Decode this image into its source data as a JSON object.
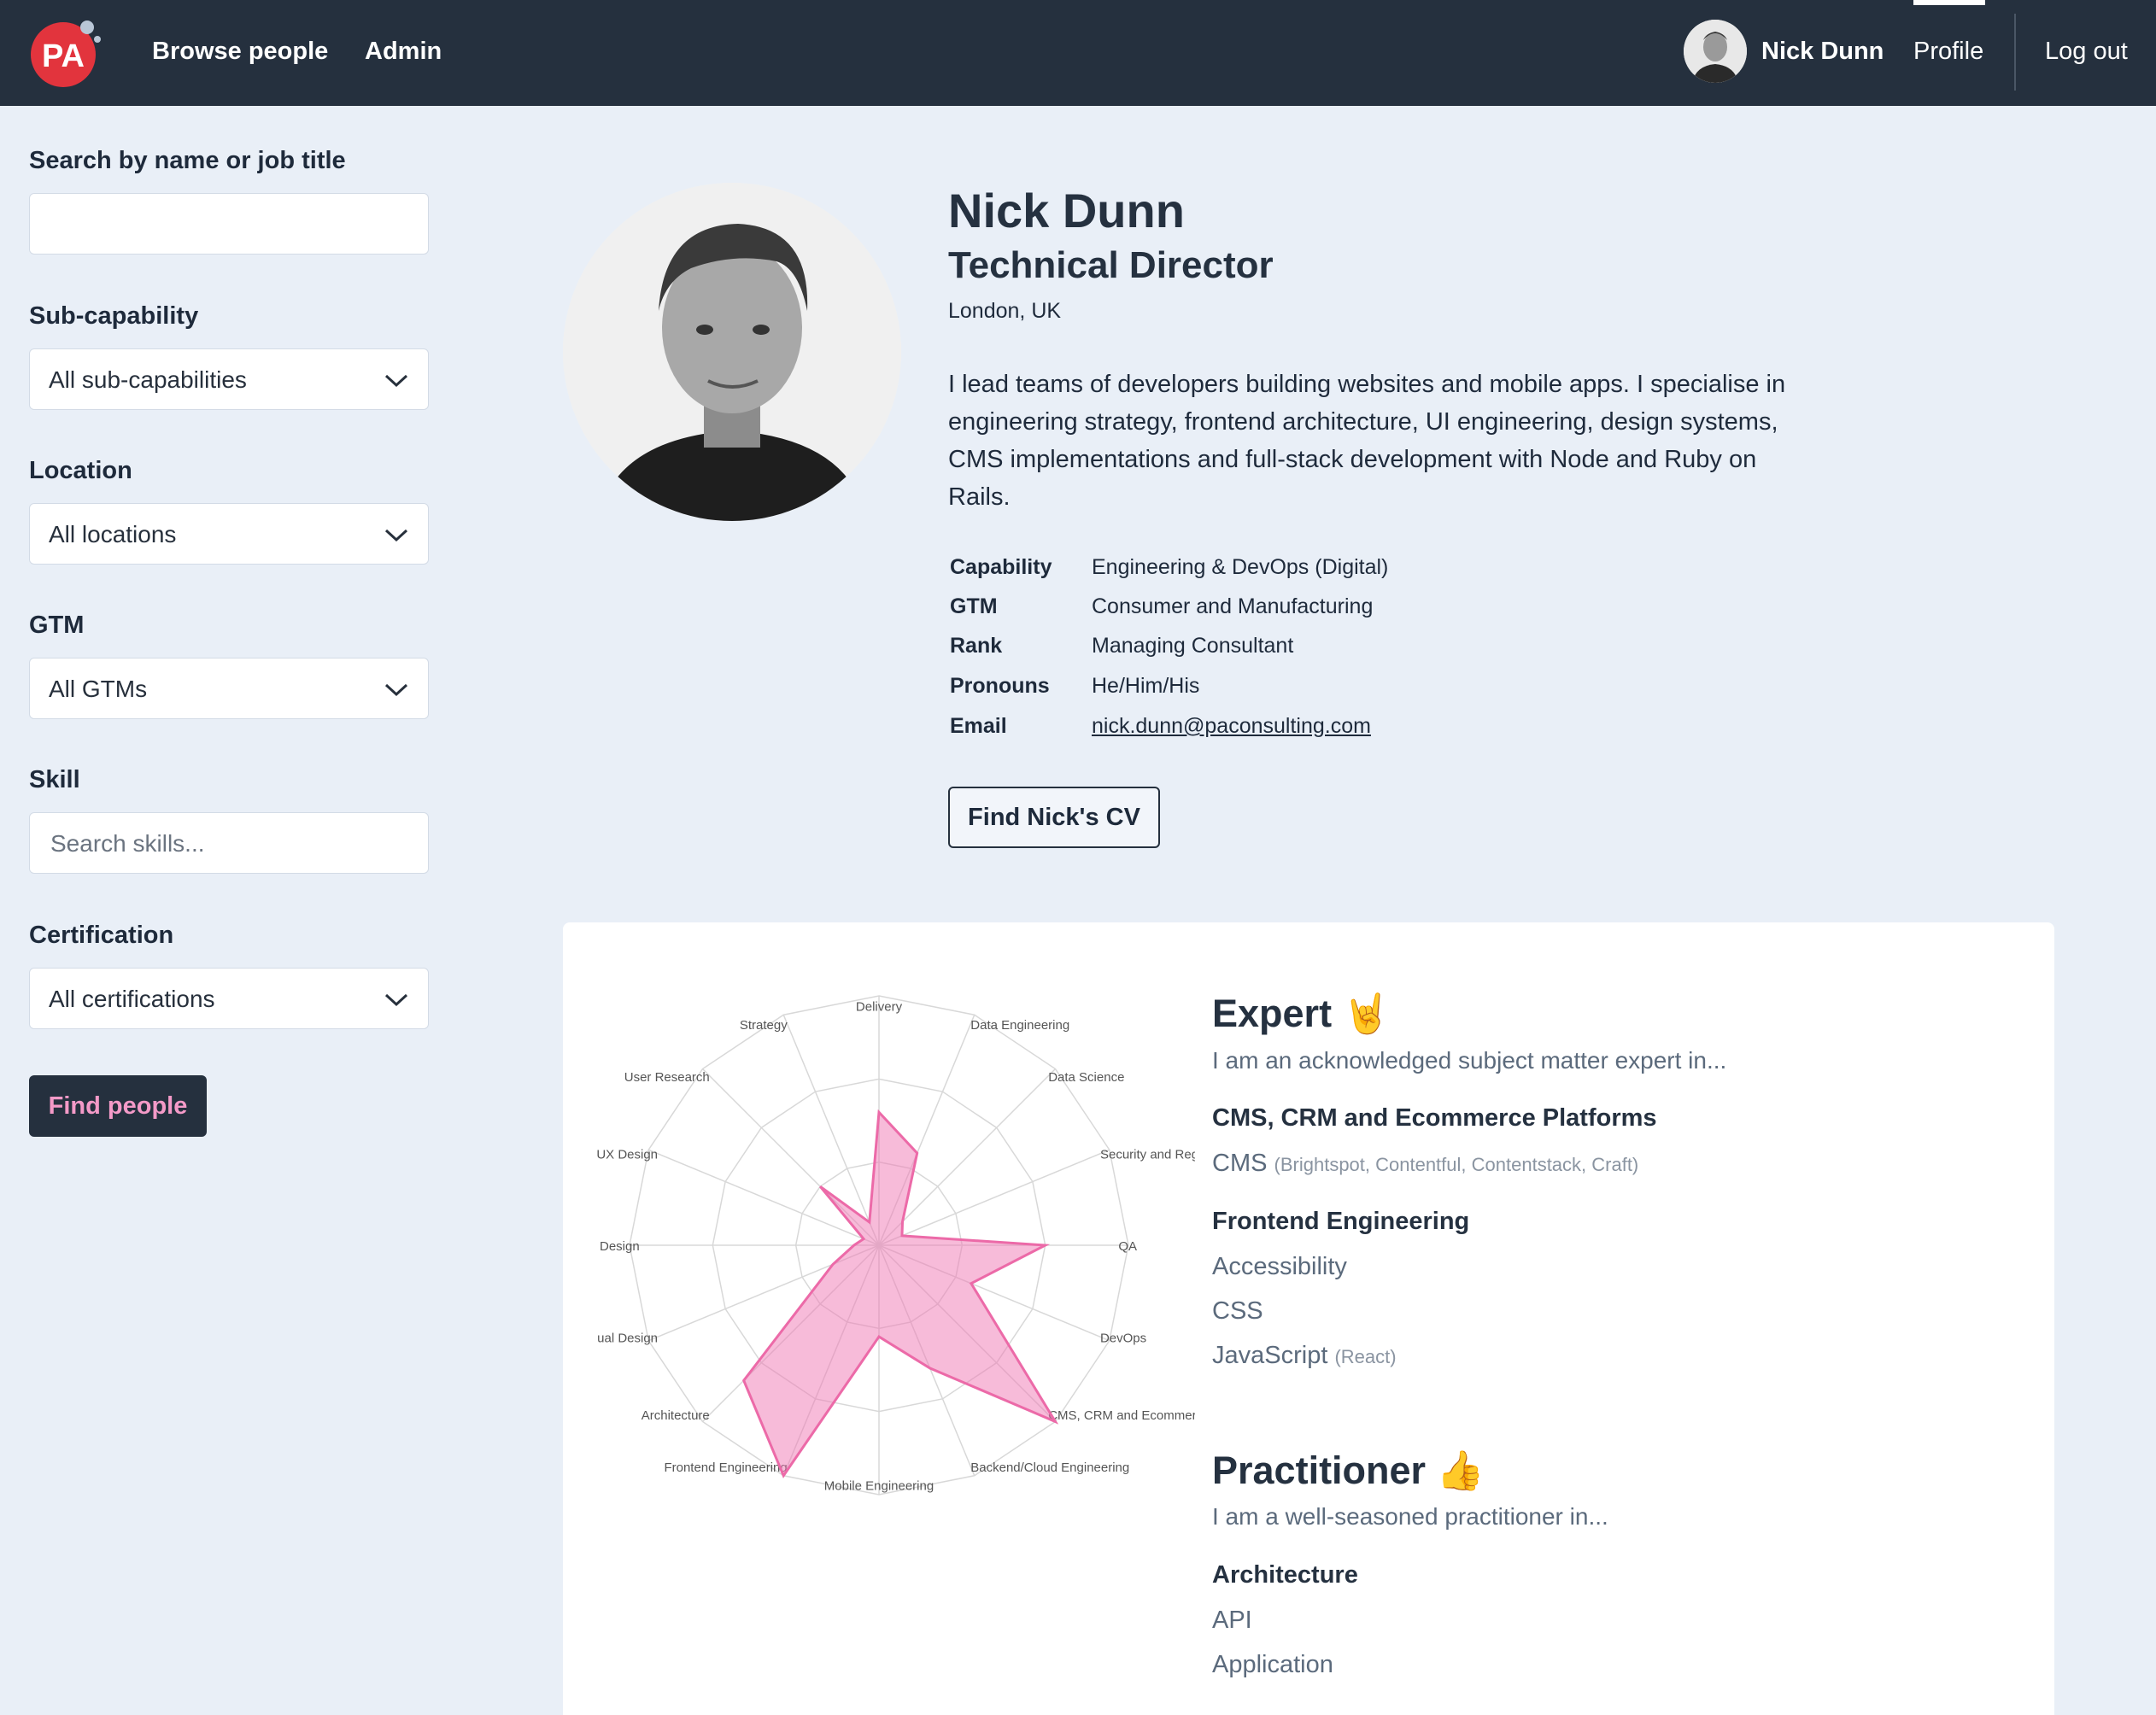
{
  "header": {
    "logo_text": "PA",
    "nav": [
      "Browse people",
      "Admin"
    ],
    "user_name": "Nick Dunn",
    "profile_label": "Profile",
    "logout_label": "Log out"
  },
  "filters": {
    "search_label": "Search by name or job title",
    "search_value": "",
    "subcap_label": "Sub-capability",
    "subcap_value": "All sub-capabilities",
    "location_label": "Location",
    "location_value": "All locations",
    "gtm_label": "GTM",
    "gtm_value": "All GTMs",
    "skill_label": "Skill",
    "skill_placeholder": "Search skills...",
    "cert_label": "Certification",
    "cert_value": "All certifications",
    "find_label": "Find people"
  },
  "profile": {
    "name": "Nick Dunn",
    "title": "Technical Director",
    "location": "London, UK",
    "bio": "I lead teams of developers building websites and mobile apps. I specialise in engineering strategy, frontend architecture, UI engineering, design systems, CMS implementations and full-stack development with Node and Ruby on Rails.",
    "details": [
      {
        "label": "Capability",
        "value": "Engineering & DevOps (Digital)"
      },
      {
        "label": "GTM",
        "value": "Consumer and Manufacturing"
      },
      {
        "label": "Rank",
        "value": "Managing Consultant"
      },
      {
        "label": "Pronouns",
        "value": "He/Him/His"
      },
      {
        "label": "Email",
        "value": "nick.dunn@paconsulting.com"
      }
    ],
    "cv_button": "Find Nick's CV"
  },
  "chart_data": {
    "type": "radar",
    "categories": [
      "Delivery",
      "Data Engineering",
      "Data Science",
      "Security and Regulatory",
      "QA",
      "DevOps",
      "CMS, CRM and Ecommerce Platforms",
      "Backend/Cloud Engineering",
      "Mobile Engineering",
      "Frontend Engineering",
      "Architecture",
      "Visual Design",
      "Content Design",
      "UX Design",
      "User Research",
      "Strategy"
    ],
    "values": [
      1.6,
      1.2,
      0.4,
      0.3,
      2.0,
      1.2,
      3.0,
      1.6,
      1.1,
      3.0,
      2.3,
      0.6,
      0.3,
      0.2,
      1.0,
      0.3
    ],
    "rmax": 3,
    "rings": 3
  },
  "skills": {
    "expert": {
      "title": "Expert",
      "emoji": "🤘",
      "desc": "I am an acknowledged subject matter expert in...",
      "groups": [
        {
          "name": "CMS, CRM and Ecommerce Platforms",
          "items": [
            {
              "name": "CMS",
              "sub": "(Brightspot, Contentful, Contentstack, Craft)"
            }
          ]
        },
        {
          "name": "Frontend Engineering",
          "items": [
            {
              "name": "Accessibility",
              "sub": ""
            },
            {
              "name": "CSS",
              "sub": ""
            },
            {
              "name": "JavaScript",
              "sub": "(React)"
            }
          ]
        }
      ]
    },
    "practitioner": {
      "title": "Practitioner",
      "emoji": "👍",
      "desc": "I am a well-seasoned practitioner in...",
      "groups": [
        {
          "name": "Architecture",
          "items": [
            {
              "name": "API",
              "sub": ""
            },
            {
              "name": "Application",
              "sub": ""
            }
          ]
        }
      ]
    }
  },
  "colors": {
    "header_bg": "#25303e",
    "page_bg": "#e9eff7",
    "accent_pink": "#f49ac8",
    "logo_red": "#e2343d"
  }
}
